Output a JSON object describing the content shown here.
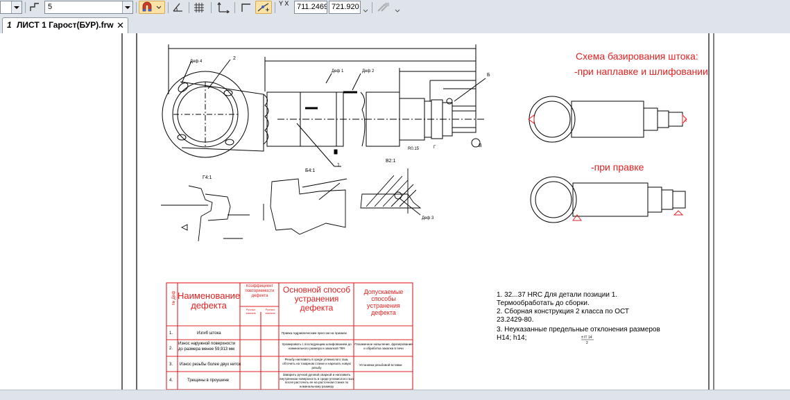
{
  "toolbar": {
    "line_style_value": "",
    "step_value": "5",
    "coord_x": "711.2469",
    "coord_y": "721.920",
    "xy_label": "Y X"
  },
  "tab": {
    "number": "1",
    "title": "ЛИСТ 1 Гарост(БУР).frw"
  },
  "drawing": {
    "scheme_title": "Схема базирования штока:",
    "scheme_grinding": "-при наплавке и шлифовании",
    "scheme_straightening": "-при правке",
    "callouts": {
      "c2": "2",
      "def4": "Деф 4",
      "def1": "Деф 1",
      "def2": "Деф 2",
      "b_letter": "Б",
      "g_letter": "Г",
      "v_letter": "В",
      "r15": "R0.15",
      "c1": "1",
      "g41": "Г4:1",
      "b41": "Б4:1",
      "v21": "В2:1",
      "def3": "Деф 3",
      "a_letter": "А"
    },
    "table": {
      "headers": {
        "num": "№ Деф",
        "name": "Наименование дефекта",
        "coef": "Коэффициент повторяемости дефекта",
        "coef_sub1": "Ручных заказов",
        "coef_sub2": "Ручных заказов",
        "method": "Основной способ устранения дефекта",
        "extra": "Допускаемые способы устранения дефекта"
      },
      "rows": [
        {
          "num": "1.",
          "name": "Изгиб штока",
          "method": "Правка гидравлическим прессом на призмах",
          "extra": ""
        },
        {
          "num": "2.",
          "name": "Износ наружной поверхности до размера менее 59,913 мм",
          "method": "Хромировать с последующим шлифованием до номинального размера и закалкой ТВЧ",
          "extra": "Плазменное напыление, фрезерование и обработка закалка в печи"
        },
        {
          "num": "3.",
          "name": "Износ резьбы более двух ниток",
          "method": "Резьбу наплавить в среде углекислого газа, обточить на токарном станке и нарезать новую резьбу",
          "extra": "Установка резьбовой вставки"
        },
        {
          "num": "4.",
          "name": "Трещины в проушине",
          "method": "Заварить ручной дуговой сваркой и наплавить внутреннюю поверхность в среде углекислого газа после расточить ее на расточном станке по номинальному размеру",
          "extra": ""
        }
      ]
    },
    "notes": {
      "n1": "1. 32...37 HRC Для детали позиции 1.",
      "n1b": "Термообработать до сборки.",
      "n2": "2. Сборная конструкция 2 класса по ОСТ",
      "n2b": "23.2429-80.",
      "n3": "3. Неуказанные предельные отклонения размеров",
      "n3b": "H14; h14;",
      "n3c": "± IT 14",
      "n3d": "2"
    }
  }
}
